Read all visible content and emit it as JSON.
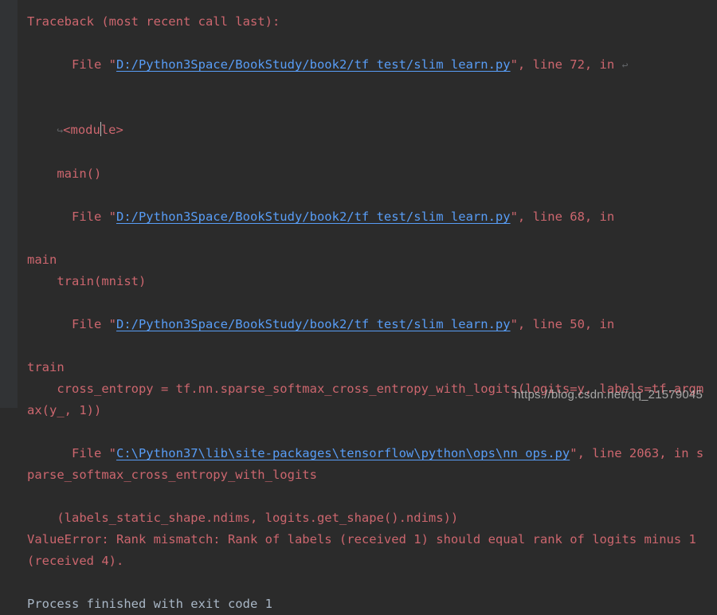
{
  "colors": {
    "bg": "#2b2b2b",
    "gutter": "#313335",
    "text": "#a9b7c6",
    "error": "#cc666e",
    "link": "#589df6"
  },
  "traceback": {
    "header": "Traceback (most recent call last):",
    "frames": [
      {
        "file_prefix": "  File \"",
        "path": "D:/Python3Space/BookStudy/book2/tf_test/slim_learn.py",
        "suffix": "\", line 72, in ",
        "location_wrapped_prefix": "<modu",
        "location_wrapped_suffix": "le>",
        "code": "    main()"
      },
      {
        "file_prefix": "  File \"",
        "path": "D:/Python3Space/BookStudy/book2/tf_test/slim_learn.py",
        "suffix": "\", line 68, in ",
        "location": "main",
        "code": "    train(mnist)"
      },
      {
        "file_prefix": "  File \"",
        "path": "D:/Python3Space/BookStudy/book2/tf_test/slim_learn.py",
        "suffix": "\", line 50, in ",
        "location": "train",
        "code": "    cross_entropy = tf.nn.sparse_softmax_cross_entropy_with_logits(logits=y, labels=tf.argmax(y_, 1))"
      },
      {
        "file_prefix": "  File \"",
        "path": "C:\\Python37\\lib\\site-packages\\tensorflow\\python\\ops\\nn_ops.py",
        "suffix": "\", line 2063, in sparse_softmax_cross_entropy_with_logits",
        "code": "    (labels_static_shape.ndims, logits.get_shape().ndims))"
      }
    ],
    "error": "ValueError: Rank mismatch: Rank of labels (received 1) should equal rank of logits minus 1 (received 4)."
  },
  "process_exit": "Process finished with exit code 1",
  "watermark": "https://blog.csdn.net/qq_21579045",
  "wrap_glyph_right": "↩",
  "wrap_glyph_left": "↪"
}
